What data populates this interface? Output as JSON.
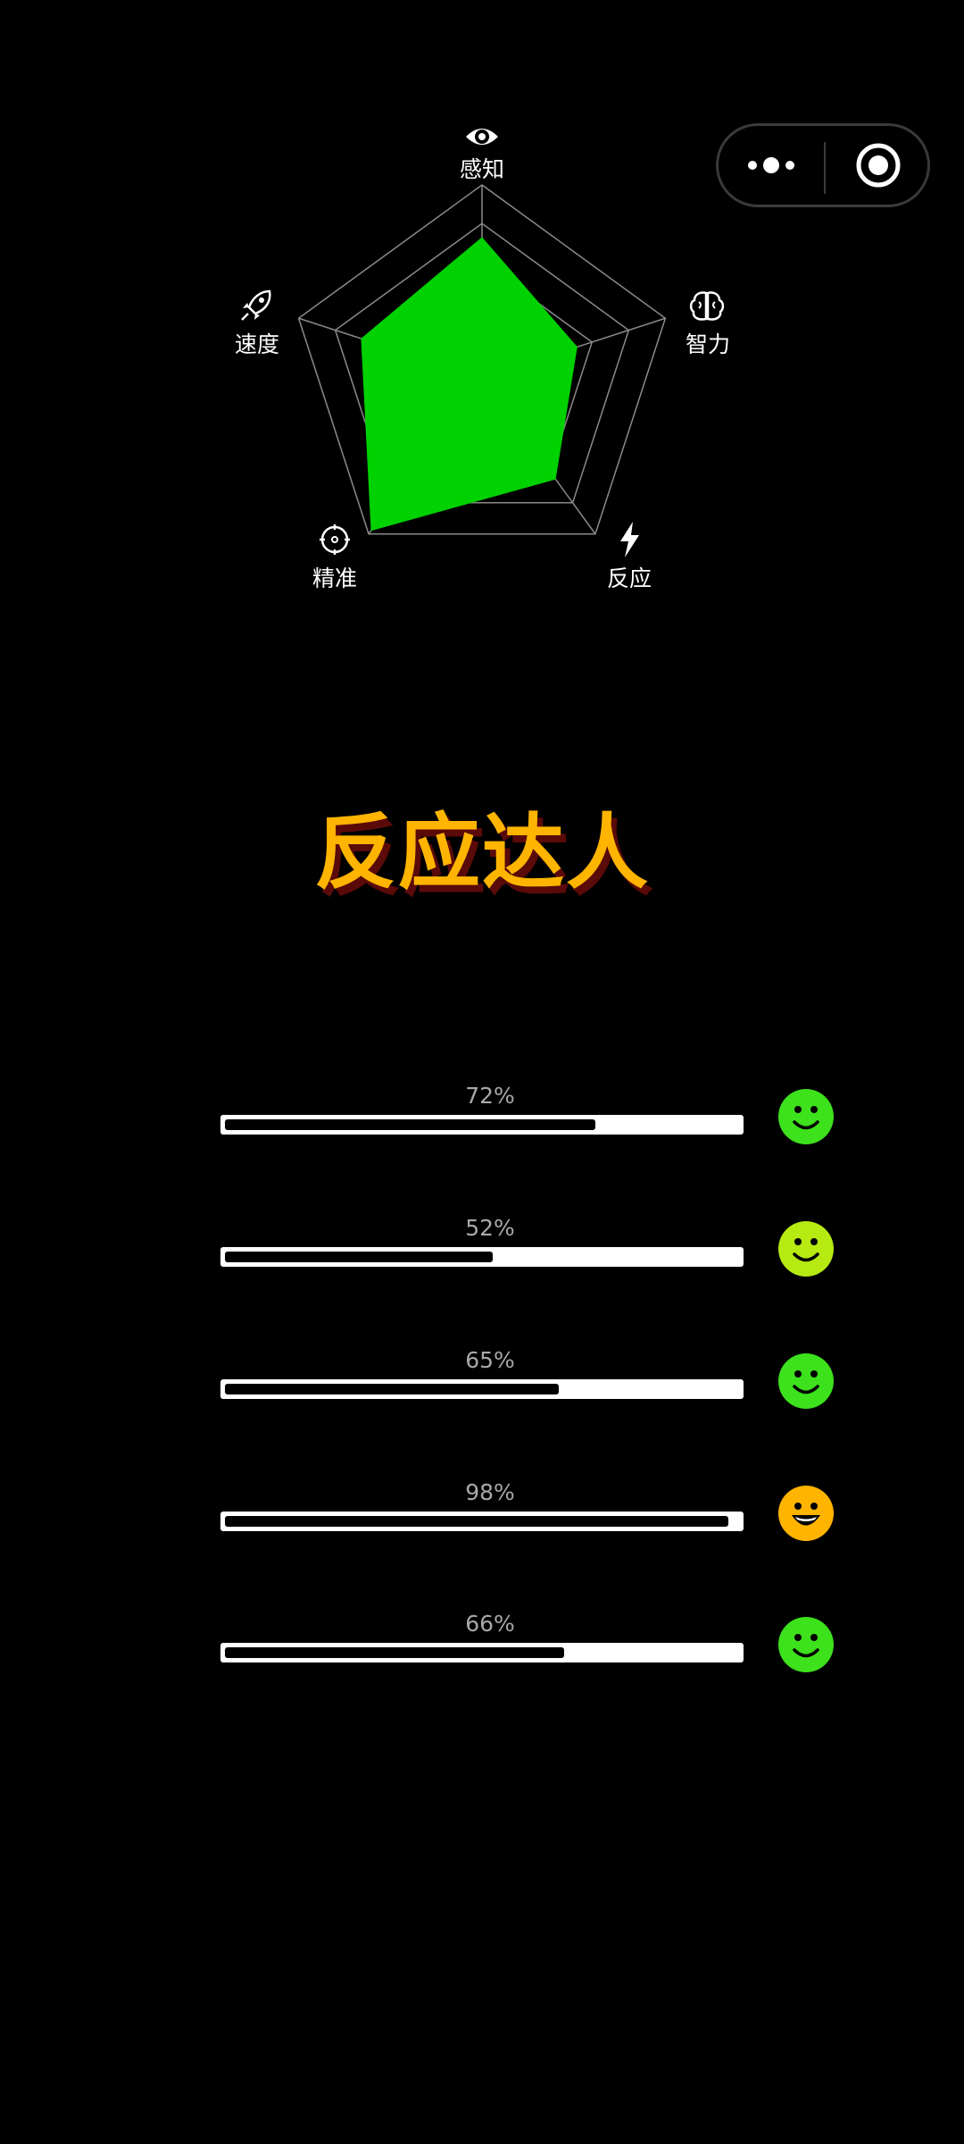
{
  "radar": {
    "axes": [
      {
        "label": "感知",
        "icon": "eye-icon",
        "value": 0.73
      },
      {
        "label": "智力",
        "icon": "brain-icon",
        "value": 0.52
      },
      {
        "label": "反应",
        "icon": "lightning-icon",
        "value": 0.65
      },
      {
        "label": "精准",
        "icon": "crosshair-icon",
        "value": 0.98
      },
      {
        "label": "速度",
        "icon": "rocket-icon",
        "value": 0.66
      }
    ],
    "fill_color": "#00d100",
    "grid_color": "#8a8a8a"
  },
  "title": "反应达人",
  "title_color": "#ffb400",
  "stats": [
    {
      "label": "72%",
      "value": 0.72,
      "face": "smile",
      "face_color": "#3de11c"
    },
    {
      "label": "52%",
      "value": 0.52,
      "face": "smile",
      "face_color": "#b6ea12"
    },
    {
      "label": "65%",
      "value": 0.65,
      "face": "smile",
      "face_color": "#3de11c"
    },
    {
      "label": "98%",
      "value": 0.98,
      "face": "grin",
      "face_color": "#ffb400"
    },
    {
      "label": "66%",
      "value": 0.66,
      "face": "smile",
      "face_color": "#3de11c"
    }
  ],
  "capsule": {
    "more_icon": "more-dots-icon",
    "close_icon": "target-close-icon"
  }
}
